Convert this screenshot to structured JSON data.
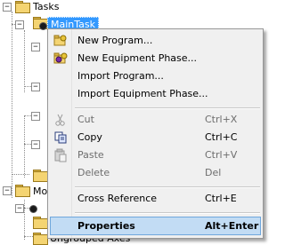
{
  "tree": {
    "root_label": "Tasks",
    "selected_label": "MainTask",
    "module_label_partial": "Mo",
    "bottom_label": "Ungrouped Axes"
  },
  "menu": {
    "items": [
      {
        "label": "New Program...",
        "shortcut": "",
        "icon": "new-program-icon"
      },
      {
        "label": "New Equipment Phase...",
        "shortcut": "",
        "icon": "new-equipment-phase-icon"
      },
      {
        "label": "Import Program...",
        "shortcut": "",
        "icon": ""
      },
      {
        "label": "Import Equipment Phase...",
        "shortcut": "",
        "icon": ""
      },
      {
        "label": "Cut",
        "shortcut": "Ctrl+X",
        "icon": "scissors-icon"
      },
      {
        "label": "Copy",
        "shortcut": "Ctrl+C",
        "icon": "copy-icon"
      },
      {
        "label": "Paste",
        "shortcut": "Ctrl+V",
        "icon": "paste-icon"
      },
      {
        "label": "Delete",
        "shortcut": "Del",
        "icon": ""
      },
      {
        "label": "Cross Reference",
        "shortcut": "Ctrl+E",
        "icon": ""
      },
      {
        "label": "Properties",
        "shortcut": "Alt+Enter",
        "icon": ""
      }
    ]
  },
  "colors": {
    "selection": "#3399ff",
    "menu_background": "#f0f0f0",
    "menu_highlight": "#c2dcf4"
  }
}
